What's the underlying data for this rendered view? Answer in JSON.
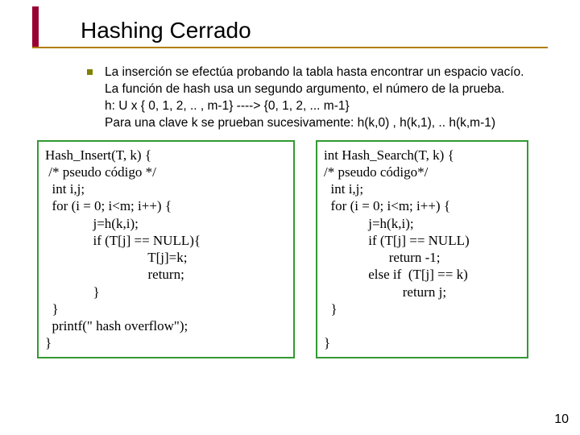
{
  "title": "Hashing Cerrado",
  "bullet": {
    "l1": "La inserción se efectúa probando la tabla hasta encontrar un espacio vacío.",
    "l2": "La función de hash usa un segundo argumento, el número de la prueba.",
    "l3": "h: U x { 0, 1, 2, .. , m-1} ----> {0, 1, 2, ... m-1}",
    "l4": "Para una clave k se prueban sucesivamente: h(k,0) , h(k,1), .. h(k,m-1)"
  },
  "code_left": "Hash_Insert(T, k) {\n /* pseudo código */\n  int i,j;\n  for (i = 0; i<m; i++) {\n              j=h(k,i);\n              if (T[j] == NULL){\n                              T[j]=k;\n                              return;\n              }\n  }\n  printf(\" hash overflow\");\n}",
  "code_right": "int Hash_Search(T, k) {\n/* pseudo código*/\n  int i,j;\n  for (i = 0; i<m; i++) {\n             j=h(k,i);\n             if (T[j] == NULL)\n                   return -1;\n             else if  (T[j] == k)\n                       return j;\n  }\n\n}",
  "slide_number": "10"
}
